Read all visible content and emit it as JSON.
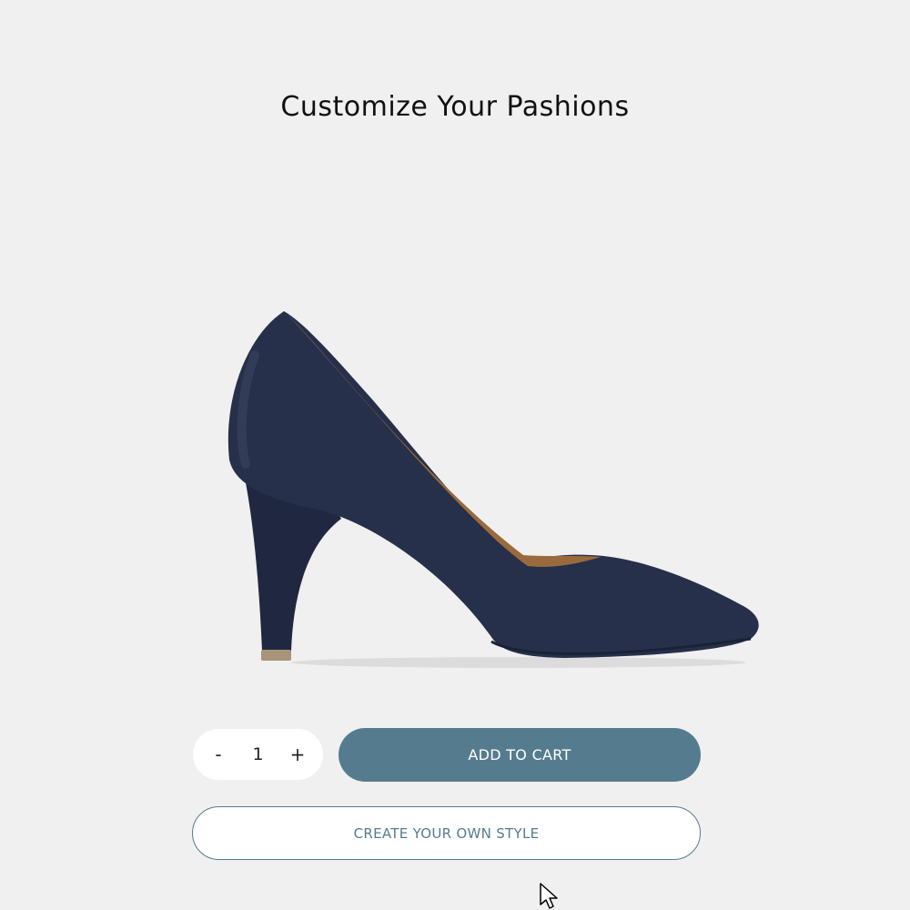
{
  "page": {
    "title": "Customize Your Pashions"
  },
  "product": {
    "image_icon": "high-heel-pump-image",
    "shoe_color": "#26304a",
    "lining_color": "#9a6a3c"
  },
  "quantity": {
    "decrement_label": "-",
    "value": "1",
    "increment_label": "+"
  },
  "actions": {
    "add_to_cart_label": "ADD TO CART",
    "create_style_label": "CREATE YOUR OWN STYLE"
  },
  "colors": {
    "background": "#f0f0f0",
    "accent": "#557c8e",
    "outline_text": "#557c8e"
  },
  "cursor": {
    "icon": "mouse-pointer-icon"
  }
}
